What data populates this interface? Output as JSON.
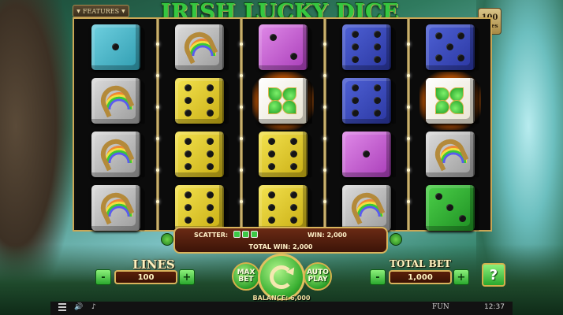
{
  "header": {
    "features_label": "FEATURES",
    "title": "IRISH LUCKY DICE",
    "lines_badge_number": "100",
    "lines_badge_label": "Lines"
  },
  "reels": [
    [
      "teal-die-1",
      "horseshoe",
      "silver-horseshoe",
      "silver-horseshoe"
    ],
    [
      "silver-horseshoe",
      "yellow-die-6",
      "yellow-die-6",
      "yellow-die-6"
    ],
    [
      "purple-die-2",
      "clover",
      "yellow-die-6",
      "yellow-die-6"
    ],
    [
      "blue-die-6",
      "blue-die-6",
      "purple-die-1",
      "silver-horseshoe"
    ],
    [
      "blue-die-5",
      "clover",
      "silver-horseshoe",
      "green-die-3"
    ]
  ],
  "win_panel": {
    "scatter_label": "SCATTER:",
    "win_label": "WIN: 2,000",
    "total_win_label": "TOTAL WIN: 2,000"
  },
  "controls": {
    "lines_title": "LINES",
    "lines_value": "100",
    "total_bet_title": "TOTAL BET",
    "total_bet_value": "1,000",
    "minus": "-",
    "plus": "+",
    "max_bet_line1": "MAX",
    "max_bet_line2": "BET",
    "auto_play_line1": "AUTO",
    "auto_play_line2": "PLAY",
    "help": "?",
    "balance": "BALANCE: 6,000"
  },
  "bottom_bar": {
    "mode": "FUN",
    "time": "12:37"
  },
  "colors": {
    "title_green": "#35c840",
    "frame_gold": "#c9a655",
    "panel_brown": "#5a1f0a"
  }
}
